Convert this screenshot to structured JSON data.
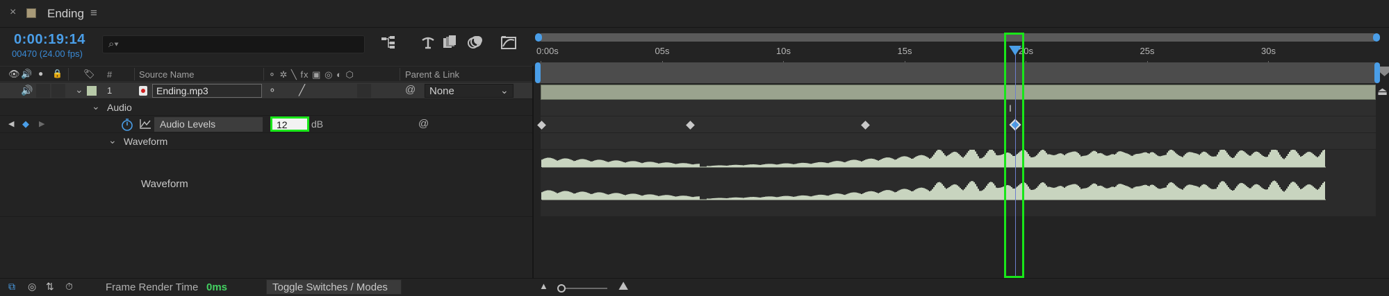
{
  "tab": {
    "title": "Ending",
    "close_glyph": "×",
    "menu_glyph": "≡",
    "swatch_color": "#a89a78"
  },
  "comp": {
    "timecode": "0:00:19:14",
    "frames": "00470 (24.00 fps)"
  },
  "search": {
    "placeholder": "",
    "icon": "search-icon"
  },
  "headers": {
    "source_name": "Source Name",
    "number": "#",
    "switches": "⚬ ✲ ╲ fx ▣ ◎ ◐ ⬡",
    "parent_link": "Parent & Link"
  },
  "layer": {
    "number": "1",
    "name": "Ending.mp3",
    "parent": "None",
    "label_color": "#b7c9a8"
  },
  "properties": {
    "audio_group": "Audio",
    "levels_name": "Audio Levels",
    "levels_value": "12",
    "levels_unit": "dB",
    "waveform_group": "Waveform",
    "waveform_label": "Waveform"
  },
  "ruler": {
    "ticks": [
      "0:00s",
      "05s",
      "10s",
      "15s",
      "20s",
      "25s",
      "30s"
    ]
  },
  "keyframes_seconds": [
    0,
    6.2,
    13.4,
    19.58
  ],
  "playhead_seconds": 19.58,
  "bottom": {
    "frame_render_label": "Frame Render Time",
    "frame_render_value": "0ms",
    "toggle_label": "Toggle Switches / Modes"
  },
  "colors": {
    "accent": "#4a9ee8",
    "highlight": "#19e619",
    "waveform": "#c8d4bf",
    "green_text": "#43d061"
  }
}
